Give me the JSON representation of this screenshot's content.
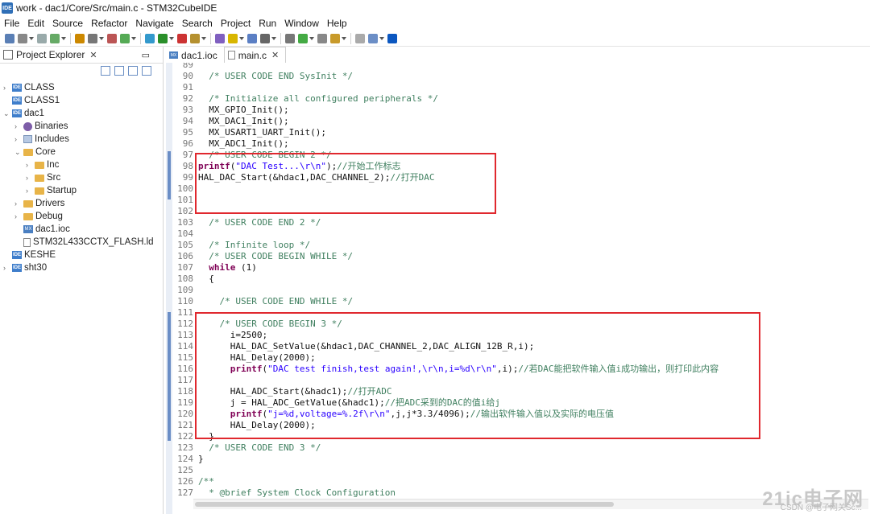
{
  "window": {
    "title": "work - dac1/Core/Src/main.c - STM32CubeIDE",
    "logo": "IDE"
  },
  "menu": [
    "File",
    "Edit",
    "Source",
    "Refactor",
    "Navigate",
    "Search",
    "Project",
    "Run",
    "Window",
    "Help"
  ],
  "explorer": {
    "tab_label": "Project Explorer",
    "close": "✕",
    "tree": [
      {
        "label": "CLASS",
        "depth": 0,
        "twisty": "›",
        "icon": "project-icon"
      },
      {
        "label": "CLASS1",
        "depth": 0,
        "twisty": "",
        "icon": "project-icon"
      },
      {
        "label": "dac1",
        "depth": 0,
        "twisty": "⌄",
        "icon": "project-icon"
      },
      {
        "label": "Binaries",
        "depth": 1,
        "twisty": "›",
        "icon": "gear-icon"
      },
      {
        "label": "Includes",
        "depth": 1,
        "twisty": "›",
        "icon": "includes-icon"
      },
      {
        "label": "Core",
        "depth": 1,
        "twisty": "⌄",
        "icon": "folder-icon"
      },
      {
        "label": "Inc",
        "depth": 2,
        "twisty": "›",
        "icon": "folder-icon"
      },
      {
        "label": "Src",
        "depth": 2,
        "twisty": "›",
        "icon": "folder-icon"
      },
      {
        "label": "Startup",
        "depth": 2,
        "twisty": "›",
        "icon": "folder-icon"
      },
      {
        "label": "Drivers",
        "depth": 1,
        "twisty": "›",
        "icon": "folder-icon"
      },
      {
        "label": "Debug",
        "depth": 1,
        "twisty": "›",
        "icon": "folder-icon"
      },
      {
        "label": "dac1.ioc",
        "depth": 1,
        "twisty": "",
        "icon": "mx-icon"
      },
      {
        "label": "STM32L433CCTX_FLASH.ld",
        "depth": 1,
        "twisty": "",
        "icon": "file-icon"
      },
      {
        "label": "KESHE",
        "depth": 0,
        "twisty": "",
        "icon": "project-icon"
      },
      {
        "label": "sht30",
        "depth": 0,
        "twisty": "›",
        "icon": "project-icon"
      }
    ]
  },
  "tabs": [
    {
      "label": "dac1.ioc",
      "icon": "mx-icon",
      "active": false
    },
    {
      "label": "main.c",
      "icon": "c-file-icon",
      "active": true,
      "close": "✕"
    }
  ],
  "code_lines": [
    {
      "n": "89",
      "parts": []
    },
    {
      "n": "90",
      "parts": [
        [
          "c",
          "  "
        ],
        [
          "cmt",
          "/* USER CODE END SysInit */"
        ]
      ]
    },
    {
      "n": "91",
      "parts": []
    },
    {
      "n": "92",
      "parts": [
        [
          "c",
          "  "
        ],
        [
          "cmt",
          "/* Initialize all configured peripherals */"
        ]
      ]
    },
    {
      "n": "93",
      "parts": [
        [
          "c",
          "  MX_GPIO_Init();"
        ]
      ]
    },
    {
      "n": "94",
      "parts": [
        [
          "c",
          "  MX_DAC1_Init();"
        ]
      ]
    },
    {
      "n": "95",
      "parts": [
        [
          "c",
          "  MX_USART1_UART_Init();"
        ]
      ]
    },
    {
      "n": "96",
      "parts": [
        [
          "c",
          "  MX_ADC1_Init();"
        ]
      ]
    },
    {
      "n": "97",
      "parts": [
        [
          "c",
          "  "
        ],
        [
          "cmt",
          "/* USER CODE BEGIN 2 */"
        ]
      ]
    },
    {
      "n": "98",
      "parts": [
        [
          "kw",
          "printf"
        ],
        [
          "c",
          "("
        ],
        [
          "str",
          "\"DAC Test...\\r\\n\""
        ],
        [
          "c",
          ");"
        ],
        [
          "cnt",
          "//开始工作标志"
        ]
      ]
    },
    {
      "n": "99",
      "parts": [
        [
          "c",
          "HAL_DAC_Start(&hdac1,DAC_CHANNEL_2);"
        ],
        [
          "cnt",
          "//打开DAC"
        ]
      ]
    },
    {
      "n": "100",
      "parts": []
    },
    {
      "n": "101",
      "parts": []
    },
    {
      "n": "102",
      "parts": []
    },
    {
      "n": "103",
      "parts": [
        [
          "c",
          "  "
        ],
        [
          "cmt",
          "/* USER CODE END 2 */"
        ]
      ]
    },
    {
      "n": "104",
      "parts": []
    },
    {
      "n": "105",
      "parts": [
        [
          "c",
          "  "
        ],
        [
          "cmt",
          "/* Infinite loop */"
        ]
      ]
    },
    {
      "n": "106",
      "parts": [
        [
          "c",
          "  "
        ],
        [
          "cmt",
          "/* USER CODE BEGIN WHILE */"
        ]
      ]
    },
    {
      "n": "107",
      "parts": [
        [
          "c",
          "  "
        ],
        [
          "kw",
          "while"
        ],
        [
          "c",
          " (1)"
        ]
      ]
    },
    {
      "n": "108",
      "parts": [
        [
          "c",
          "  {"
        ]
      ]
    },
    {
      "n": "109",
      "parts": []
    },
    {
      "n": "110",
      "parts": [
        [
          "c",
          "    "
        ],
        [
          "cmt",
          "/* USER CODE END WHILE */"
        ]
      ]
    },
    {
      "n": "111",
      "parts": []
    },
    {
      "n": "112",
      "parts": [
        [
          "c",
          "    "
        ],
        [
          "cmt",
          "/* USER CODE BEGIN 3 */"
        ]
      ]
    },
    {
      "n": "113",
      "parts": [
        [
          "c",
          "      i=2500;"
        ]
      ]
    },
    {
      "n": "114",
      "parts": [
        [
          "c",
          "      HAL_DAC_SetValue(&hdac1,DAC_CHANNEL_2,DAC_ALIGN_12B_R,i);"
        ]
      ]
    },
    {
      "n": "115",
      "parts": [
        [
          "c",
          "      HAL_Delay(2000);"
        ]
      ]
    },
    {
      "n": "116",
      "parts": [
        [
          "c",
          "      "
        ],
        [
          "kw",
          "printf"
        ],
        [
          "c",
          "("
        ],
        [
          "str",
          "\"DAC test finish,test again!,\\r\\n,i=%d\\r\\n\""
        ],
        [
          "c",
          ",i);"
        ],
        [
          "cnt",
          "//若DAC能把软件输入值i成功输出，则打印此内容"
        ]
      ]
    },
    {
      "n": "117",
      "parts": []
    },
    {
      "n": "118",
      "parts": [
        [
          "c",
          "      HAL_ADC_Start(&hadc1);"
        ],
        [
          "cnt",
          "//打开ADC"
        ]
      ]
    },
    {
      "n": "119",
      "parts": [
        [
          "c",
          "      j = HAL_ADC_GetValue(&hadc1);"
        ],
        [
          "cnt",
          "//把ADC采到的DAC的值i给j"
        ]
      ]
    },
    {
      "n": "120",
      "parts": [
        [
          "c",
          "      "
        ],
        [
          "kw",
          "printf"
        ],
        [
          "c",
          "("
        ],
        [
          "str",
          "\"j=%d,voltage=%.2f\\r\\n\""
        ],
        [
          "c",
          ",j,j*3.3/4096);"
        ],
        [
          "cnt",
          "//输出软件输入值以及实际的电压值"
        ]
      ]
    },
    {
      "n": "121",
      "parts": [
        [
          "c",
          "      HAL_Delay(2000);"
        ]
      ]
    },
    {
      "n": "122",
      "parts": [
        [
          "c",
          "  }"
        ]
      ]
    },
    {
      "n": "123",
      "parts": [
        [
          "c",
          "  "
        ],
        [
          "cmt",
          "/* USER CODE END 3 */"
        ]
      ]
    },
    {
      "n": "124",
      "parts": [
        [
          "c",
          "}"
        ]
      ]
    },
    {
      "n": "125",
      "parts": []
    },
    {
      "n": "126",
      "parts": [
        [
          "cmt",
          "/**"
        ]
      ]
    },
    {
      "n": "127",
      "parts": [
        [
          "cmt",
          "  * @brief System Clock Configuration"
        ]
      ]
    }
  ],
  "watermark": "21ic电子网",
  "watermark_credit": "CSDN @电子网关Sc...",
  "colors": {
    "highlight_box": "#e0282e",
    "comment": "#3f7f5f",
    "keyword": "#7f0055",
    "string": "#2a00ff"
  }
}
